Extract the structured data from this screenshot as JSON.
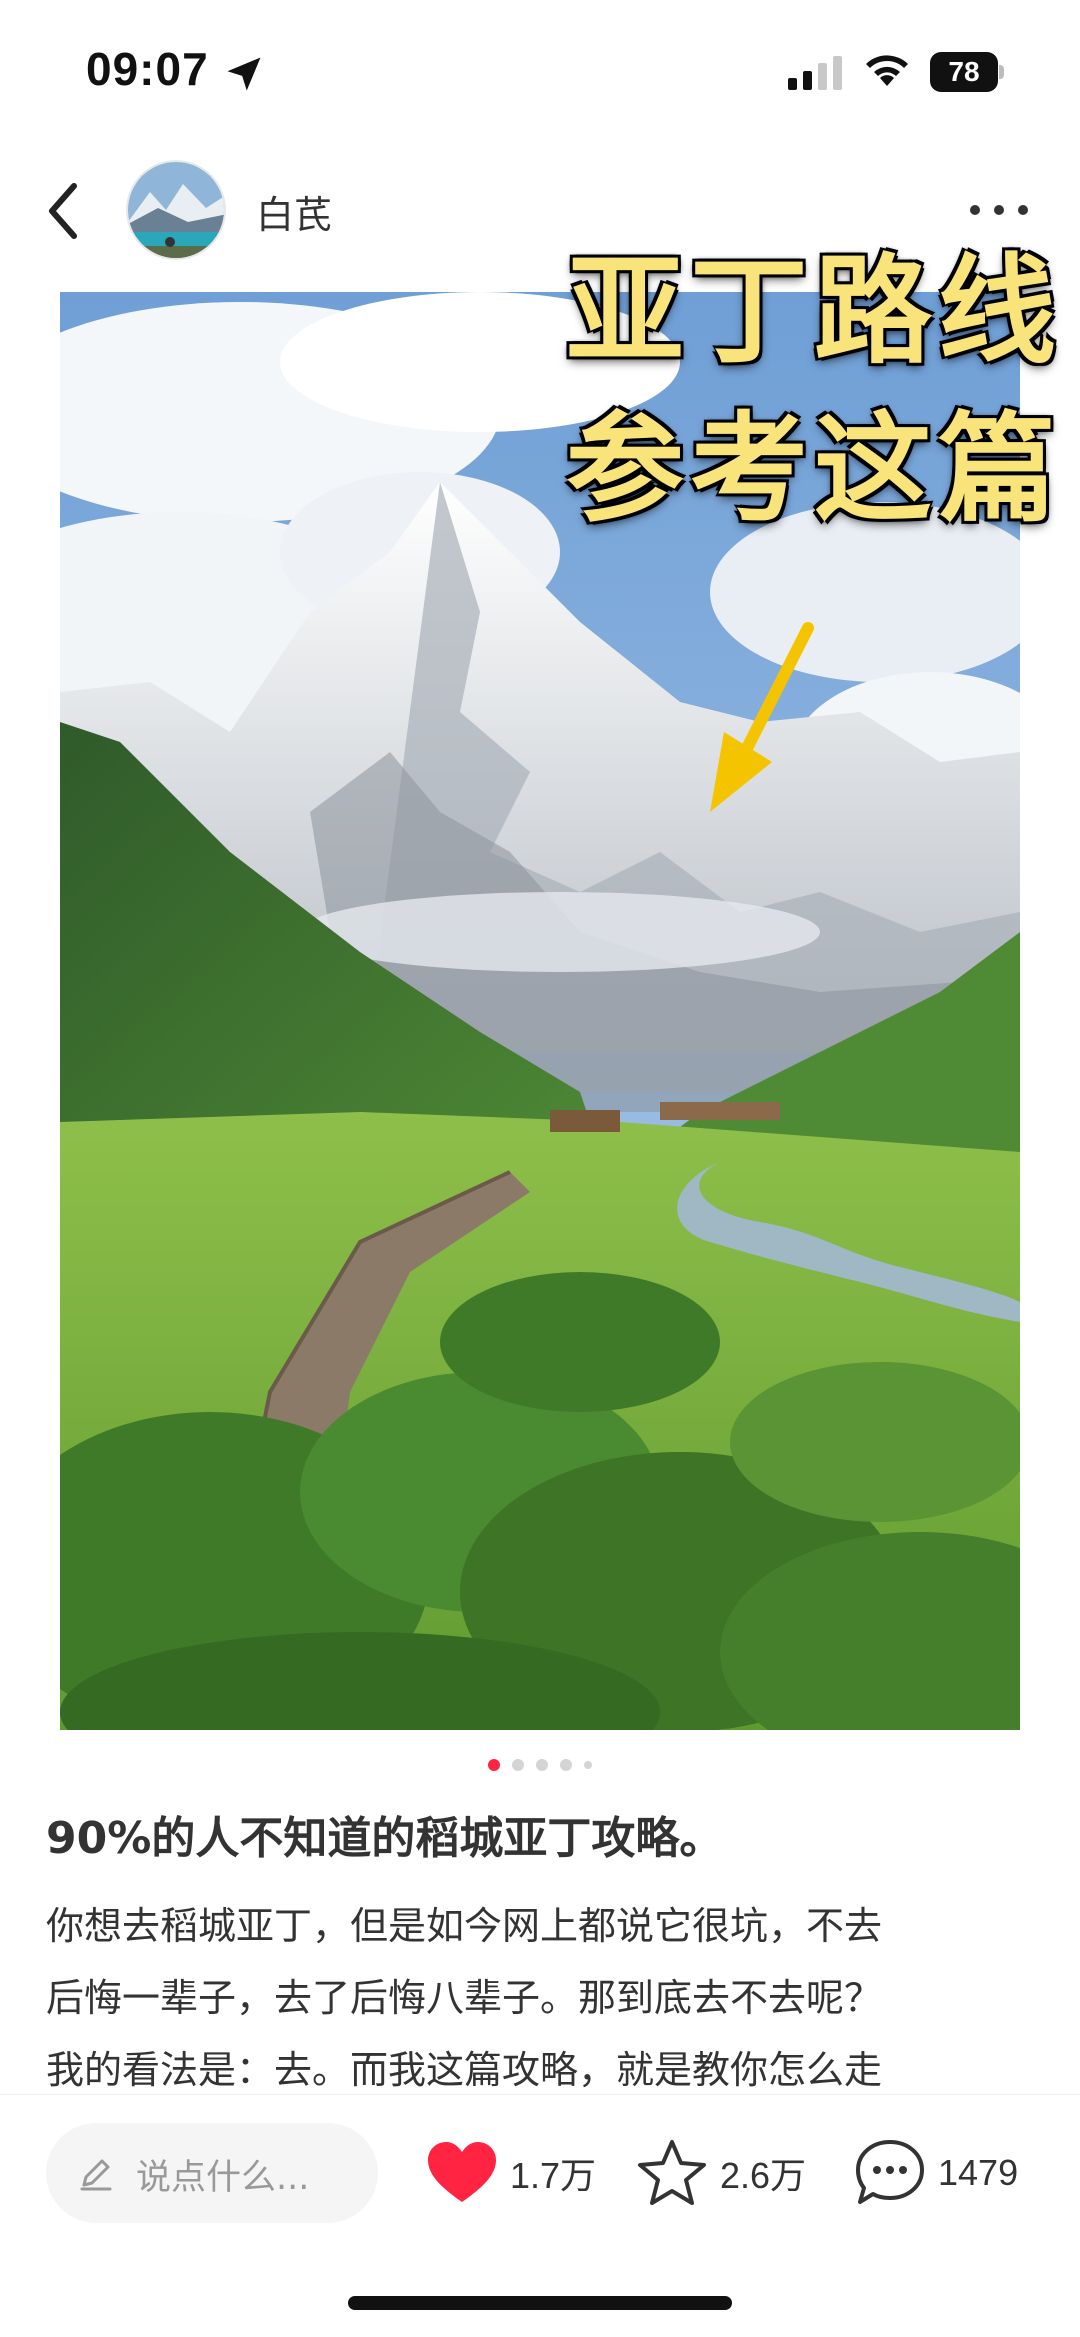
{
  "status_bar": {
    "time": "09:07",
    "battery": "78",
    "icons": [
      "location-arrow-icon",
      "cellular-signal-icon",
      "wifi-icon",
      "battery-icon"
    ]
  },
  "header": {
    "author_name": "白芪",
    "icons": [
      "chevron-left-icon",
      "more-dots-icon"
    ]
  },
  "photo": {
    "overlay_line1": "亚丁路线",
    "overlay_line2": "参考这篇"
  },
  "pagination": {
    "total": 5,
    "active_index": 0
  },
  "post": {
    "title": "90%的人不知道的稻城亚丁攻略。",
    "body_lines": [
      "你想去稻城亚丁，但是如今网上都说它很坑，不去",
      "后悔一辈子，去了后悔八辈子。那到底去不去呢？",
      "我的看法是：去。而我这篇攻略，就是教你怎么走"
    ]
  },
  "bottom_bar": {
    "comment_placeholder": "说点什么...",
    "likes": "1.7万",
    "collects": "2.6万",
    "comments": "1479",
    "colors": {
      "like": "#ff2442",
      "accent": "#ff2442"
    },
    "icons": [
      "pencil-icon",
      "heart-icon",
      "star-icon",
      "comment-bubble-icon"
    ]
  }
}
